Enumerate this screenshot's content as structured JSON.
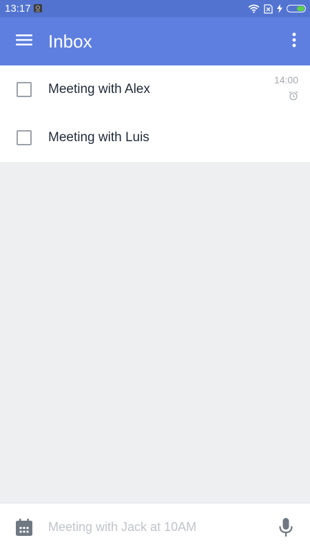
{
  "status_bar": {
    "time": "13:17",
    "icons": [
      "notification-icon",
      "wifi-icon",
      "no-sim-icon",
      "charging-icon",
      "battery-icon"
    ],
    "battery_level": 0.45,
    "battery_color": "#5cd148"
  },
  "app_bar": {
    "title": "Inbox",
    "menu_icon": "hamburger-menu-icon",
    "overflow_icon": "more-vert-icon",
    "color": "#5e7fe0"
  },
  "tasks": [
    {
      "title": "Meeting with Alex",
      "time": "14:00",
      "has_alarm": true,
      "checked": false
    },
    {
      "title": "Meeting with Luis",
      "time": "",
      "has_alarm": false,
      "checked": false
    }
  ],
  "quick_add": {
    "placeholder": "Meeting with Jack at 10AM",
    "value": "",
    "calendar_icon": "calendar-icon",
    "mic_icon": "microphone-icon"
  }
}
